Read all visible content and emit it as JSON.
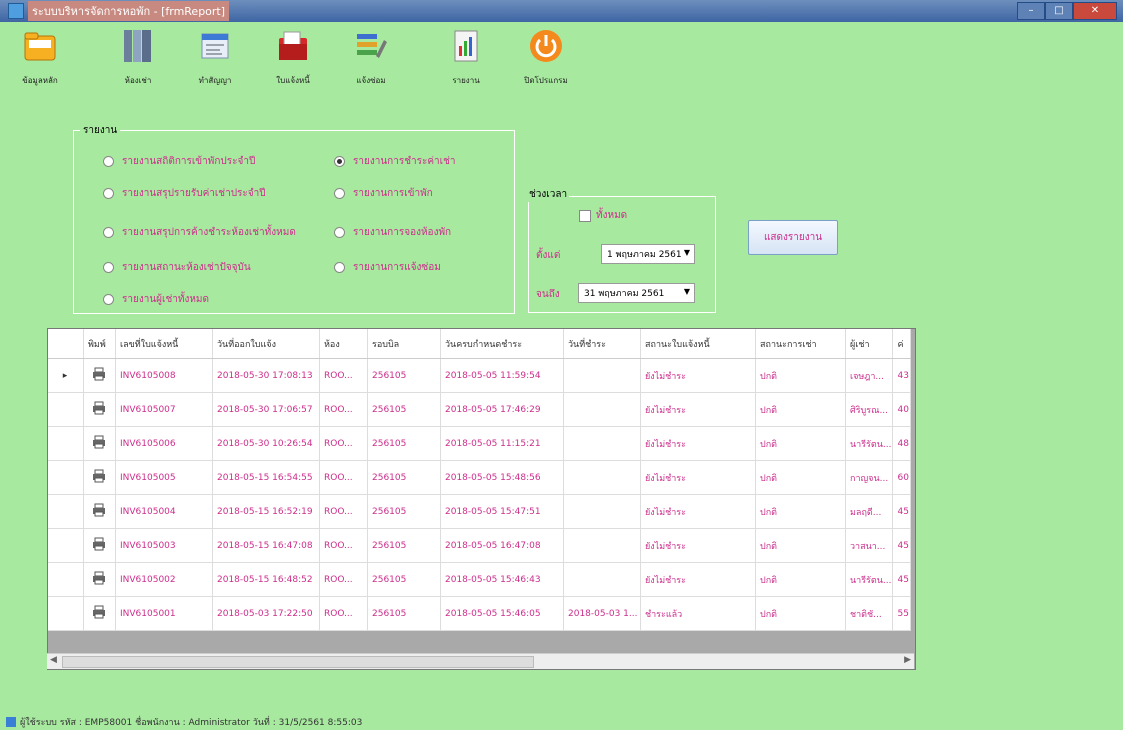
{
  "window": {
    "title": "ระบบบริหารจัดการหอพัก - [frmReport]"
  },
  "toolbar": {
    "items": [
      {
        "label": "ข้อมูลหลัก",
        "icon": "folder-icon"
      },
      {
        "label": "ห้องเช่า",
        "icon": "books-icon"
      },
      {
        "label": "ทำสัญญา",
        "icon": "contract-icon"
      },
      {
        "label": "ใบแจ้งหนี้",
        "icon": "invoice-folder-icon"
      },
      {
        "label": "แจ้งซ่อม",
        "icon": "repair-icon"
      },
      {
        "label": "รายงาน",
        "icon": "report-icon"
      },
      {
        "label": "ปิดโปรแกรม",
        "icon": "power-icon"
      }
    ]
  },
  "report_group": {
    "label": "รายงาน",
    "options": [
      {
        "label": "รายงานสถิติการเข้าพักประจำปี",
        "selected": false
      },
      {
        "label": "รายงานการชำระค่าเช่า",
        "selected": true
      },
      {
        "label": "รายงานสรุปรายรับค่าเช่าประจำปี",
        "selected": false
      },
      {
        "label": "รายงานการเข้าพัก",
        "selected": false
      },
      {
        "label": "รายงานสรุปการค้างชำระห้องเช่าทั้งหมด",
        "selected": false
      },
      {
        "label": "รายงานการจองห้องพัก",
        "selected": false
      },
      {
        "label": "รายงานสถานะห้องเช่าปัจจุบัน",
        "selected": false
      },
      {
        "label": "รายงานการแจ้งซ่อม",
        "selected": false
      },
      {
        "label": "รายงานผู้เช่าทั้งหมด",
        "selected": false
      }
    ]
  },
  "period": {
    "label": "ช่วงเวลา",
    "all_label": "ทั้งหมด",
    "from_label": "ตั้งแต่",
    "from_value": "1 พฤษภาคม 2561",
    "to_label": "จนถึง",
    "to_value": "31 พฤษภาคม 2561"
  },
  "show_button": "แสดงรายงาน",
  "table": {
    "columns": [
      "",
      "พิมพ์",
      "เลขที่ใบแจ้งหนี้",
      "วันที่ออกใบแจ้ง",
      "ห้อง",
      "รอบบิล",
      "วันครบกำหนดชำระ",
      "วันที่ชำระ",
      "สถานะใบแจ้งหนี้",
      "สถานะการเช่า",
      "ผู้เช่า",
      "ค่"
    ],
    "rows": [
      [
        "INV6105008",
        "2018-05-30 17:08:13",
        "ROO...",
        "256105",
        "2018-05-05 11:59:54",
        "",
        "ยังไม่ชำระ",
        "ปกติ",
        "เจษฎา...",
        "43"
      ],
      [
        "INV6105007",
        "2018-05-30 17:06:57",
        "ROO...",
        "256105",
        "2018-05-05 17:46:29",
        "",
        "ยังไม่ชำระ",
        "ปกติ",
        "ศิริบูรณ...",
        "40"
      ],
      [
        "INV6105006",
        "2018-05-30 10:26:54",
        "ROO...",
        "256105",
        "2018-05-05 11:15:21",
        "",
        "ยังไม่ชำระ",
        "ปกติ",
        "นารีรัตน...",
        "48"
      ],
      [
        "INV6105005",
        "2018-05-15 16:54:55",
        "ROO...",
        "256105",
        "2018-05-05 15:48:56",
        "",
        "ยังไม่ชำระ",
        "ปกติ",
        "กาญจน...",
        "60"
      ],
      [
        "INV6105004",
        "2018-05-15 16:52:19",
        "ROO...",
        "256105",
        "2018-05-05 15:47:51",
        "",
        "ยังไม่ชำระ",
        "ปกติ",
        "มลฤดี...",
        "45"
      ],
      [
        "INV6105003",
        "2018-05-15 16:47:08",
        "ROO...",
        "256105",
        "2018-05-05 16:47:08",
        "",
        "ยังไม่ชำระ",
        "ปกติ",
        "วาสนา...",
        "45"
      ],
      [
        "INV6105002",
        "2018-05-15 16:48:52",
        "ROO...",
        "256105",
        "2018-05-05 15:46:43",
        "",
        "ยังไม่ชำระ",
        "ปกติ",
        "นารีรัตน...",
        "45"
      ],
      [
        "INV6105001",
        "2018-05-03 17:22:50",
        "ROO...",
        "256105",
        "2018-05-05 15:46:05",
        "2018-05-03 1...",
        "ชำระแล้ว",
        "ปกติ",
        "ชาติชั...",
        "55"
      ]
    ]
  },
  "status_bar": {
    "text": "ผู้ใช้ระบบ รหัส : EMP58001  ชื่อพนักงาน : Administrator  วันที่ : 31/5/2561 8:55:03"
  }
}
